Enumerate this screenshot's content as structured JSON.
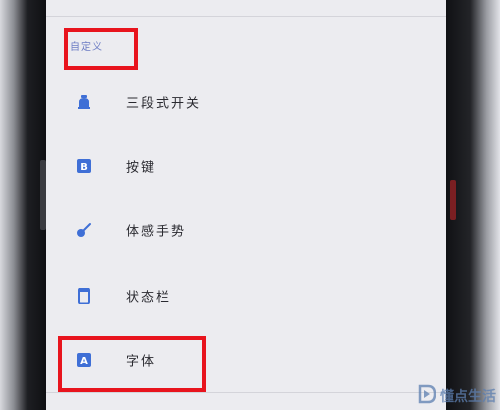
{
  "section": {
    "header": "自定义"
  },
  "menu": {
    "items": [
      {
        "label": "三段式开关",
        "icon": "alert-slider-icon"
      },
      {
        "label": "按键",
        "icon": "key-b-icon"
      },
      {
        "label": "体感手势",
        "icon": "gesture-icon"
      },
      {
        "label": "状态栏",
        "icon": "status-bar-icon"
      },
      {
        "label": "字体",
        "icon": "font-a-icon"
      }
    ]
  },
  "watermark": {
    "text": "懂点生活"
  },
  "colors": {
    "accent": "#3f6fd6",
    "header": "#6c7cc4",
    "highlight": "#e8141d"
  }
}
